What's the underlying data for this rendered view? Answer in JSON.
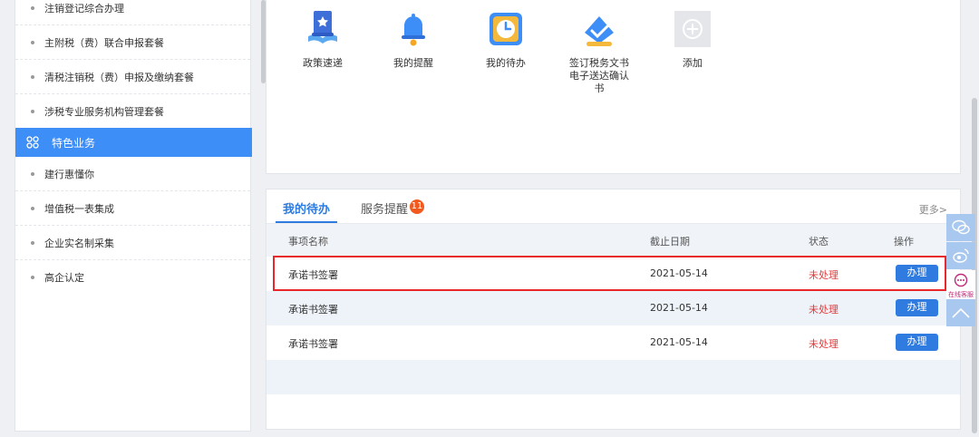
{
  "sidebar": {
    "items_top": [
      {
        "label": "注销登记综合办理"
      },
      {
        "label": "主附税（费）联合申报套餐"
      },
      {
        "label": "清税注销税（费）申报及缴纳套餐"
      },
      {
        "label": "涉税专业服务机构管理套餐"
      }
    ],
    "category": {
      "label": "特色业务",
      "icon": "grid-icon"
    },
    "items_bottom": [
      {
        "label": "建行惠懂你"
      },
      {
        "label": "增值税一表集成"
      },
      {
        "label": "企业实名制采集"
      },
      {
        "label": "高企认定"
      }
    ]
  },
  "quick_access": [
    {
      "label": "政策速递",
      "icon": "policy-book-icon"
    },
    {
      "label": "我的提醒",
      "icon": "bell-icon"
    },
    {
      "label": "我的待办",
      "icon": "clock-icon"
    },
    {
      "label": "签订税务文书电子送达确认书",
      "icon": "sign-document-icon"
    },
    {
      "label": "添加",
      "icon": "add-icon"
    }
  ],
  "tasks": {
    "tab_active": "我的待办",
    "tab_second": "服务提醒",
    "badge": "11",
    "more": "更多>",
    "headers": {
      "name": "事项名称",
      "deadline": "截止日期",
      "status": "状态",
      "action": "操作"
    },
    "rows": [
      {
        "name": "承诺书签署",
        "deadline": "2021-05-14",
        "status": "未处理",
        "action": "办理"
      },
      {
        "name": "承诺书签署",
        "deadline": "2021-05-14",
        "status": "未处理",
        "action": "办理"
      },
      {
        "name": "承诺书签署",
        "deadline": "2021-05-14",
        "status": "未处理",
        "action": "办理"
      }
    ]
  },
  "float_toolbar": {
    "service_label": "在线客服",
    "icons": [
      "wechat-icon",
      "weibo-icon",
      "online-service-icon",
      "back-to-top-icon"
    ]
  },
  "colors": {
    "accent": "#3e8ef7",
    "button": "#2f7be0",
    "status_pending": "#e03a3a",
    "badge": "#f05a1e",
    "highlight": "#e8282a"
  }
}
